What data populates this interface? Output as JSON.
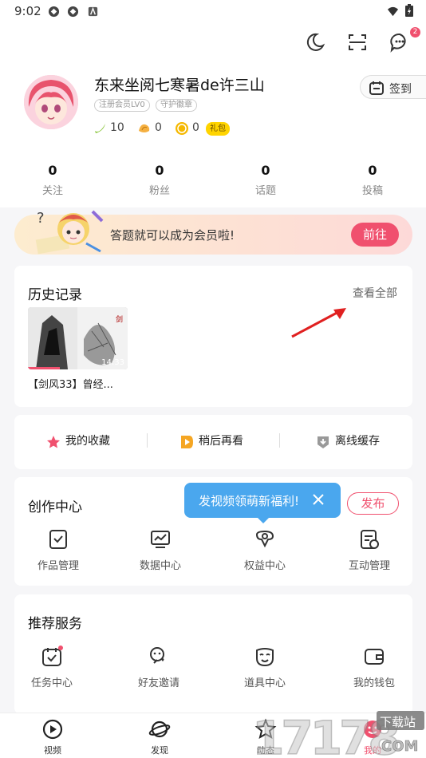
{
  "status_bar": {
    "time": "9:02"
  },
  "profile": {
    "username": "东来坐阅七寒暑de许三山",
    "tags": [
      "注册会员LV0",
      "守护徽章"
    ],
    "coins": [
      {
        "icon": "banana-icon",
        "value": "10"
      },
      {
        "icon": "shell-icon",
        "value": "0"
      },
      {
        "icon": "gold-coin-icon",
        "value": "0"
      }
    ],
    "gift_label": "礼包",
    "checkin_label": "签到",
    "stats": [
      {
        "value": "0",
        "label": "关注"
      },
      {
        "value": "0",
        "label": "粉丝"
      },
      {
        "value": "0",
        "label": "话题"
      },
      {
        "value": "0",
        "label": "投稿"
      }
    ]
  },
  "banner": {
    "text": "答题就可以成为会员啦!",
    "button": "前往"
  },
  "history": {
    "title": "历史记录",
    "see_all": "查看全部",
    "items": [
      {
        "title": "【剑风33】曾经...",
        "duration": "14:33"
      }
    ]
  },
  "quick_actions": [
    {
      "label": "我的收藏",
      "icon": "star-icon",
      "color": "#f0506e"
    },
    {
      "label": "稍后再看",
      "icon": "play-later-icon",
      "color": "#f5a623"
    },
    {
      "label": "离线缓存",
      "icon": "download-icon",
      "color": "#999999"
    }
  ],
  "creation": {
    "title": "创作中心",
    "publish_label": "发布",
    "tooltip": "发视频领萌新福利!",
    "items": [
      {
        "label": "作品管理",
        "icon": "works-icon"
      },
      {
        "label": "数据中心",
        "icon": "chart-icon"
      },
      {
        "label": "权益中心",
        "icon": "benefits-icon"
      },
      {
        "label": "互动管理",
        "icon": "interaction-icon"
      }
    ]
  },
  "services": {
    "title": "推荐服务",
    "items": [
      {
        "label": "任务中心",
        "icon": "task-icon"
      },
      {
        "label": "好友邀请",
        "icon": "invite-icon"
      },
      {
        "label": "道具中心",
        "icon": "mask-icon"
      },
      {
        "label": "我的钱包",
        "icon": "wallet-icon"
      }
    ]
  },
  "tabbar": [
    {
      "label": "视频",
      "icon": "video-tab-icon"
    },
    {
      "label": "发现",
      "icon": "planet-tab-icon"
    },
    {
      "label": "动态",
      "icon": "star-tab-icon"
    },
    {
      "label": "我的",
      "icon": "me-tab-icon"
    }
  ],
  "watermark": {
    "text": "17178",
    "sub": "下载站",
    "domain": "COM"
  },
  "colors": {
    "accent": "#f0506e",
    "tooltip": "#4aa7ee",
    "gift": "#ffd400"
  }
}
